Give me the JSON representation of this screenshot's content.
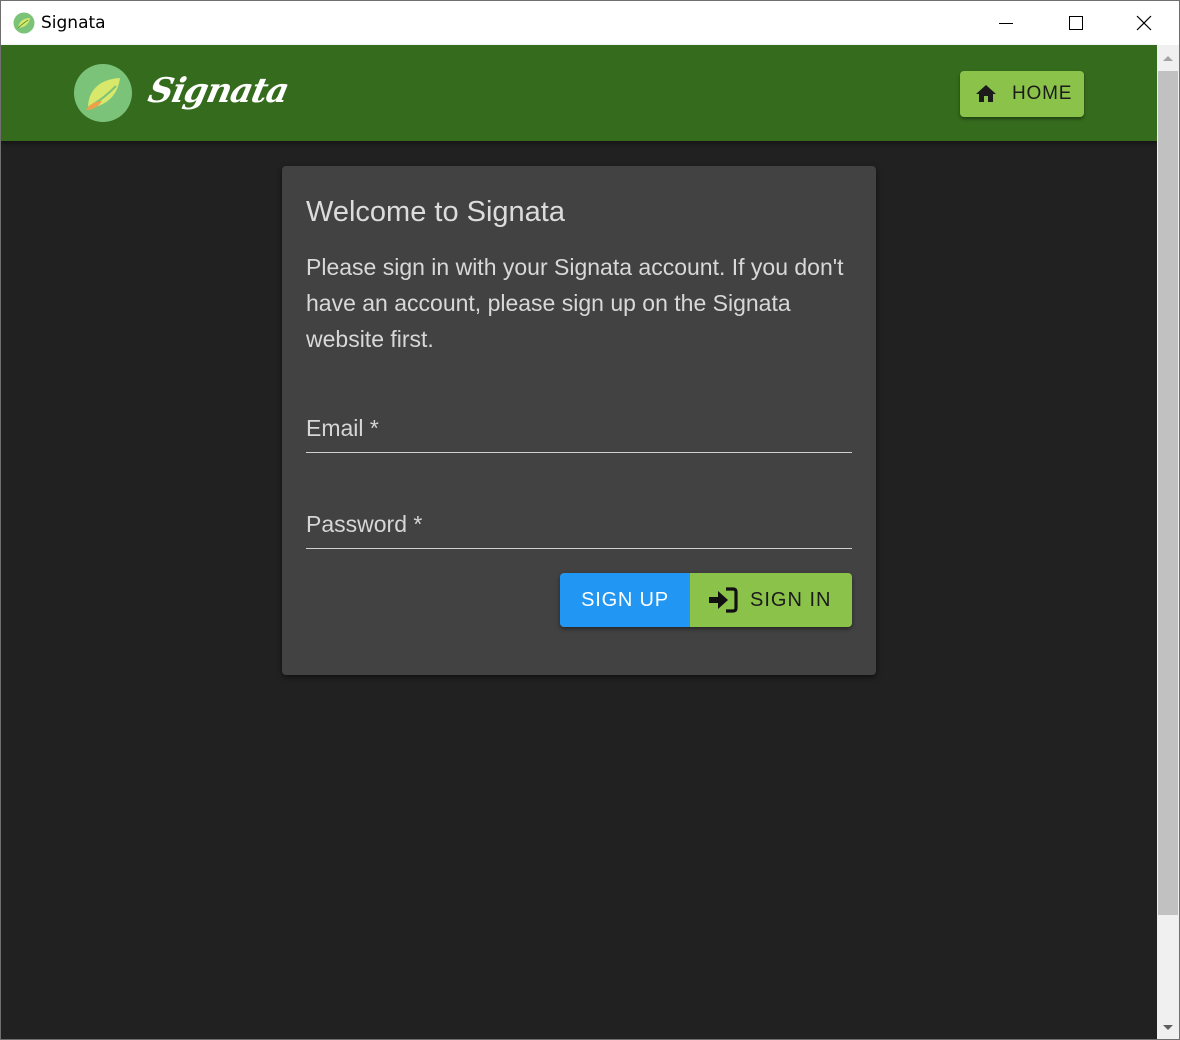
{
  "window": {
    "title": "Signata",
    "icon": "leaf-logo-icon",
    "controls": [
      "minimize-icon",
      "maximize-icon",
      "close-icon"
    ]
  },
  "header": {
    "logo_text": "Signata",
    "home_button": {
      "label": "HOME",
      "icon": "home-icon"
    },
    "colors": {
      "bar": "#356b1d",
      "button": "#8bc34a"
    }
  },
  "login_card": {
    "title": "Welcome to Signata",
    "description": "Please sign in with your Signata account. If you don't have an account, please sign up on the Signata website first.",
    "email": {
      "label": "Email *",
      "value": ""
    },
    "password": {
      "label": "Password *",
      "value": ""
    },
    "signup_button": {
      "label": "SIGN UP",
      "color": "#2196f3"
    },
    "signin_button": {
      "label": "SIGN IN",
      "icon": "sign-in-icon",
      "color": "#8bc34a"
    }
  }
}
